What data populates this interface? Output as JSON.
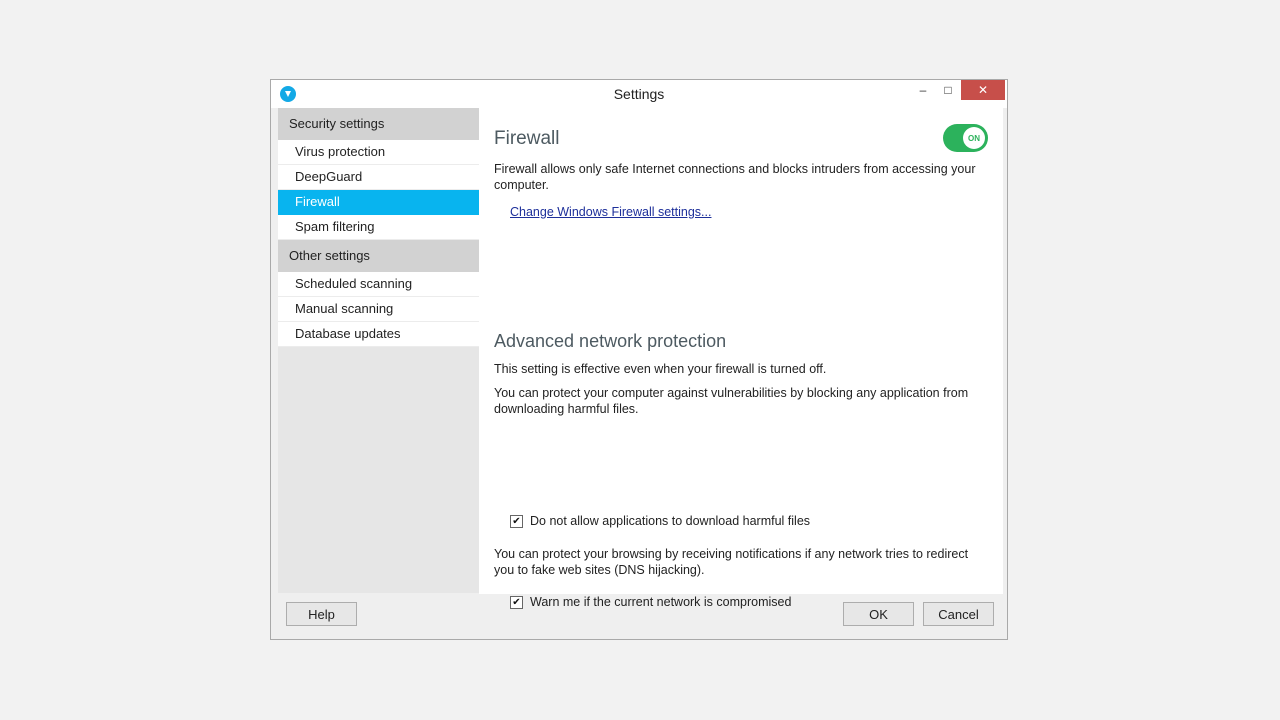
{
  "window": {
    "title": "Settings",
    "icon": "f-secure-shield-icon",
    "controls": {
      "minimize": "minimize-icon",
      "maximize": "maximize-icon",
      "close": "close-icon"
    }
  },
  "sidebar": {
    "groups": [
      {
        "header": "Security settings",
        "items": [
          {
            "label": "Virus protection"
          },
          {
            "label": "DeepGuard"
          },
          {
            "label": "Firewall",
            "active": true
          },
          {
            "label": "Spam filtering"
          }
        ]
      },
      {
        "header": "Other settings",
        "items": [
          {
            "label": "Scheduled scanning"
          },
          {
            "label": "Manual scanning"
          },
          {
            "label": "Database updates"
          }
        ]
      }
    ]
  },
  "firewall": {
    "title": "Firewall",
    "toggle": "ON",
    "description": "Firewall allows only safe Internet connections and blocks intruders from accessing your computer.",
    "link": "Change Windows Firewall settings..."
  },
  "advanced": {
    "title": "Advanced network protection",
    "note": "This setting is effective even when your firewall is turned off.",
    "desc1": "You can protect your computer against vulnerabilities by blocking any application from downloading harmful files.",
    "check1": {
      "label": "Do not allow applications to download harmful files",
      "checked": true
    },
    "desc2": "You can protect your browsing by receiving notifications if any network tries to redirect you to fake web sites (DNS hijacking).",
    "check2": {
      "label": "Warn me if the current network is compromised",
      "checked": true
    }
  },
  "footer": {
    "help": "Help",
    "ok": "OK",
    "cancel": "Cancel"
  },
  "colors": {
    "accent": "#08b4ef",
    "toggle_on": "#2cb25c",
    "close_button": "#c74f4a",
    "link": "#1d2f9a"
  }
}
